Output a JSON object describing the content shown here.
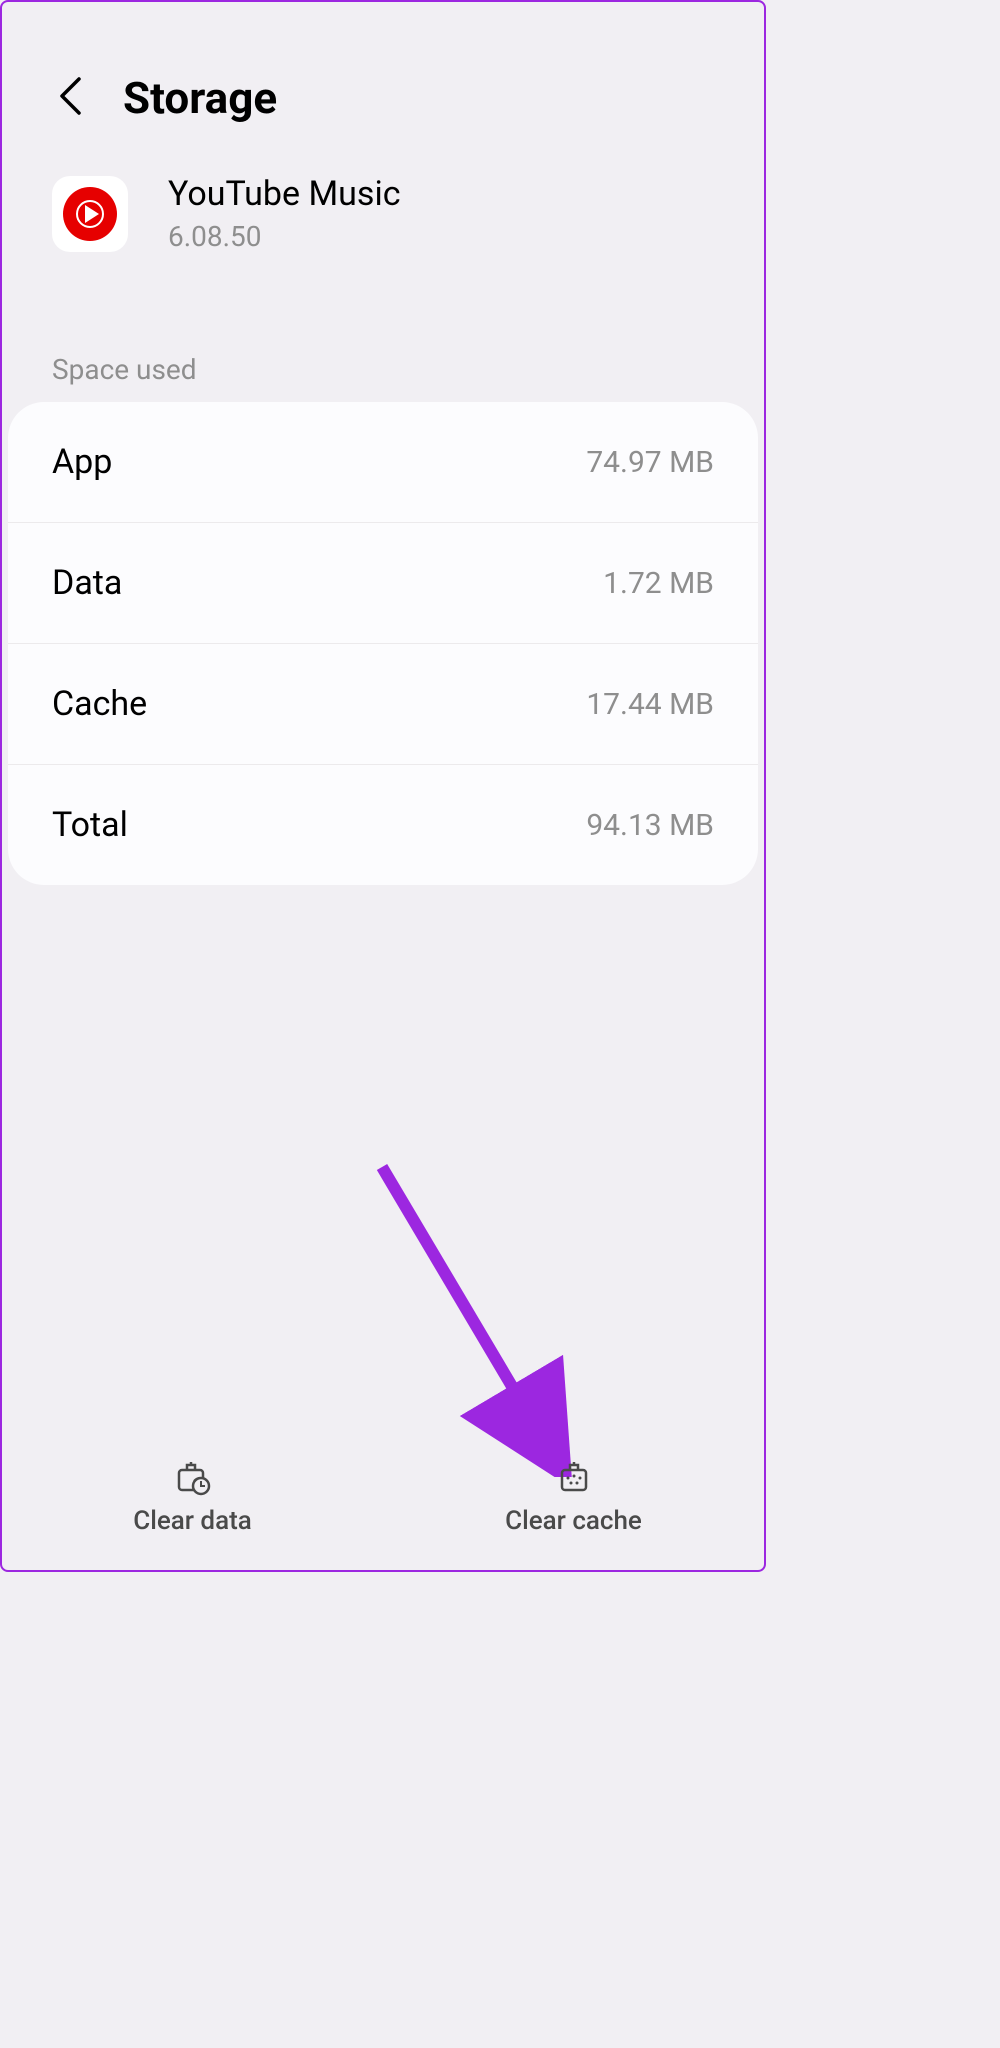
{
  "header": {
    "title": "Storage"
  },
  "app": {
    "name": "YouTube Music",
    "version": "6.08.50"
  },
  "section_label": "Space used",
  "rows": [
    {
      "label": "App",
      "value": "74.97 MB"
    },
    {
      "label": "Data",
      "value": "1.72 MB"
    },
    {
      "label": "Cache",
      "value": "17.44 MB"
    },
    {
      "label": "Total",
      "value": "94.13 MB"
    }
  ],
  "buttons": {
    "clear_data": "Clear data",
    "clear_cache": "Clear cache"
  }
}
